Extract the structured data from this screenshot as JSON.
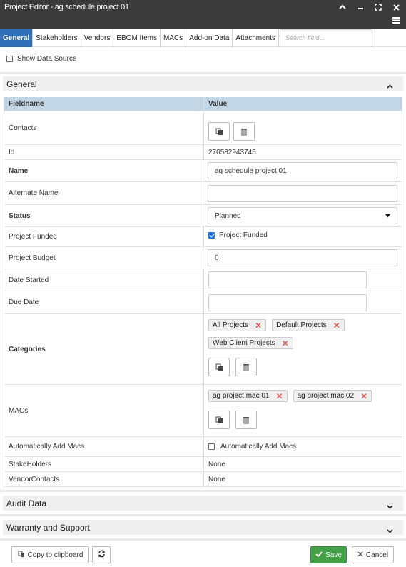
{
  "window": {
    "title": "Project Editor - ag schedule project 01"
  },
  "tabs": [
    {
      "label": "General"
    },
    {
      "label": "Stakeholders"
    },
    {
      "label": "Vendors"
    },
    {
      "label": "EBOM Items"
    },
    {
      "label": "MACs"
    },
    {
      "label": "Add-on Data"
    },
    {
      "label": "Attachments"
    }
  ],
  "search": {
    "placeholder": "Search field..."
  },
  "show_data_source": {
    "label": "Show Data Source",
    "checked": false
  },
  "sections": {
    "general": "General",
    "audit": "Audit Data",
    "warranty": "Warranty and Support"
  },
  "grid": {
    "headers": {
      "fieldname": "Fieldname",
      "value": "Value"
    },
    "rows": {
      "contacts": {
        "label": "Contacts"
      },
      "id": {
        "label": "Id",
        "value": "270582943745"
      },
      "name": {
        "label": "Name",
        "value": "ag schedule project 01"
      },
      "alternate_name": {
        "label": "Alternate Name",
        "value": ""
      },
      "status": {
        "label": "Status",
        "value": "Planned"
      },
      "project_funded": {
        "label": "Project Funded",
        "checkbox_label": "Project Funded",
        "checked": true
      },
      "project_budget": {
        "label": "Project Budget",
        "value": "0"
      },
      "date_started": {
        "label": "Date Started",
        "value": ""
      },
      "due_date": {
        "label": "Due Date",
        "value": ""
      },
      "categories": {
        "label": "Categories",
        "chips": [
          "All Projects",
          "Default Projects",
          "Web Client Projects"
        ]
      },
      "macs": {
        "label": "MACs",
        "chips": [
          "ag project mac 01",
          "ag project mac 02"
        ]
      },
      "auto_add_macs": {
        "label": "Automatically Add Macs",
        "checkbox_label": "Automatically Add Macs",
        "checked": false
      },
      "stakeholders": {
        "label": "StakeHolders",
        "value": "None"
      },
      "vendor_contacts": {
        "label": "VendorContacts",
        "value": "None"
      }
    }
  },
  "footer": {
    "copy_label": "Copy to clipboard",
    "save_label": "Save",
    "cancel_label": "Cancel"
  },
  "colors": {
    "titlebar": "#3b3b3b",
    "active_tab": "#2e6fb8",
    "grid_header": "#c3d6e6",
    "save": "#43a047",
    "chip_remove": "#e53935"
  }
}
